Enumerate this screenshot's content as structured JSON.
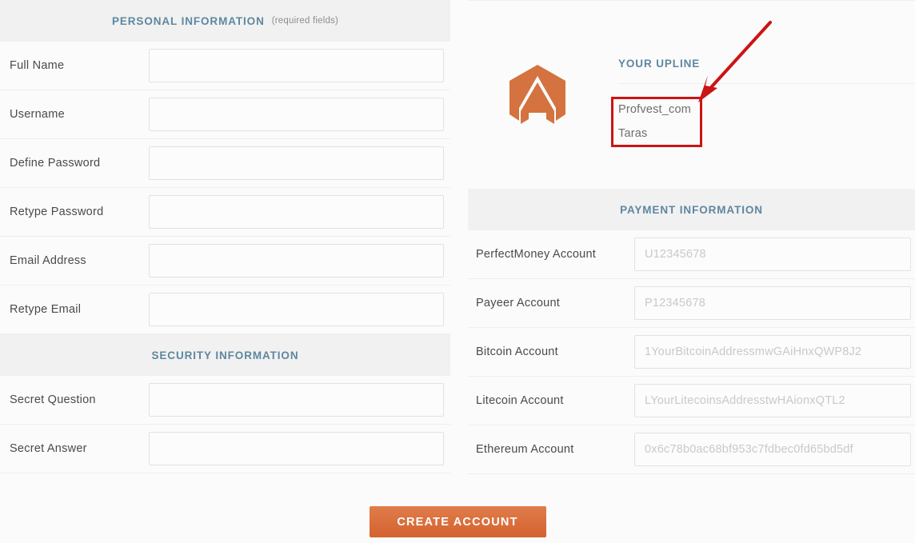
{
  "left_panel": {
    "personal_section": {
      "title": "PERSONAL INFORMATION",
      "note": "(required fields)",
      "fields": [
        {
          "label": "Full Name",
          "value": "",
          "placeholder": ""
        },
        {
          "label": "Username",
          "value": "",
          "placeholder": ""
        },
        {
          "label": "Define Password",
          "value": "",
          "placeholder": ""
        },
        {
          "label": "Retype Password",
          "value": "",
          "placeholder": ""
        },
        {
          "label": "Email Address",
          "value": "",
          "placeholder": ""
        },
        {
          "label": "Retype Email",
          "value": "",
          "placeholder": ""
        }
      ]
    },
    "security_section": {
      "title": "SECURITY INFORMATION",
      "fields": [
        {
          "label": "Secret Question",
          "value": "",
          "placeholder": ""
        },
        {
          "label": "Secret Answer",
          "value": "",
          "placeholder": ""
        }
      ]
    }
  },
  "right_panel": {
    "upline": {
      "title": "YOUR UPLINE",
      "logo_icon": "hexagon-arrow-logo-icon",
      "username": "Profvest_com",
      "fullname": "Taras"
    },
    "payment_section": {
      "title": "PAYMENT INFORMATION",
      "fields": [
        {
          "label": "PerfectMoney Account",
          "value": "",
          "placeholder": "U12345678"
        },
        {
          "label": "Payeer Account",
          "value": "",
          "placeholder": "P12345678"
        },
        {
          "label": "Bitcoin Account",
          "value": "",
          "placeholder": "1YourBitcoinAddressmwGAiHnxQWP8J2"
        },
        {
          "label": "Litecoin Account",
          "value": "",
          "placeholder": "LYourLitecoinsAddresstwHAionxQTL2"
        },
        {
          "label": "Ethereum Account",
          "value": "",
          "placeholder": "0x6c78b0ac68bf953c7fdbec0fd65bd5df"
        }
      ]
    }
  },
  "footer": {
    "submit_label": "CREATE ACCOUNT"
  },
  "annotations": {
    "highlight_box_color": "#cc1414",
    "arrow_color": "#cc1414",
    "arrow_icon": "annotation-arrow-icon"
  },
  "colors": {
    "section_title": "#5e87a0",
    "band_bg": "#f1f1f1",
    "page_bg": "#fbfbfb",
    "brand_orange": "#d4622f",
    "label_text": "#4a4a4a",
    "placeholder_text": "#c9c9c9"
  }
}
